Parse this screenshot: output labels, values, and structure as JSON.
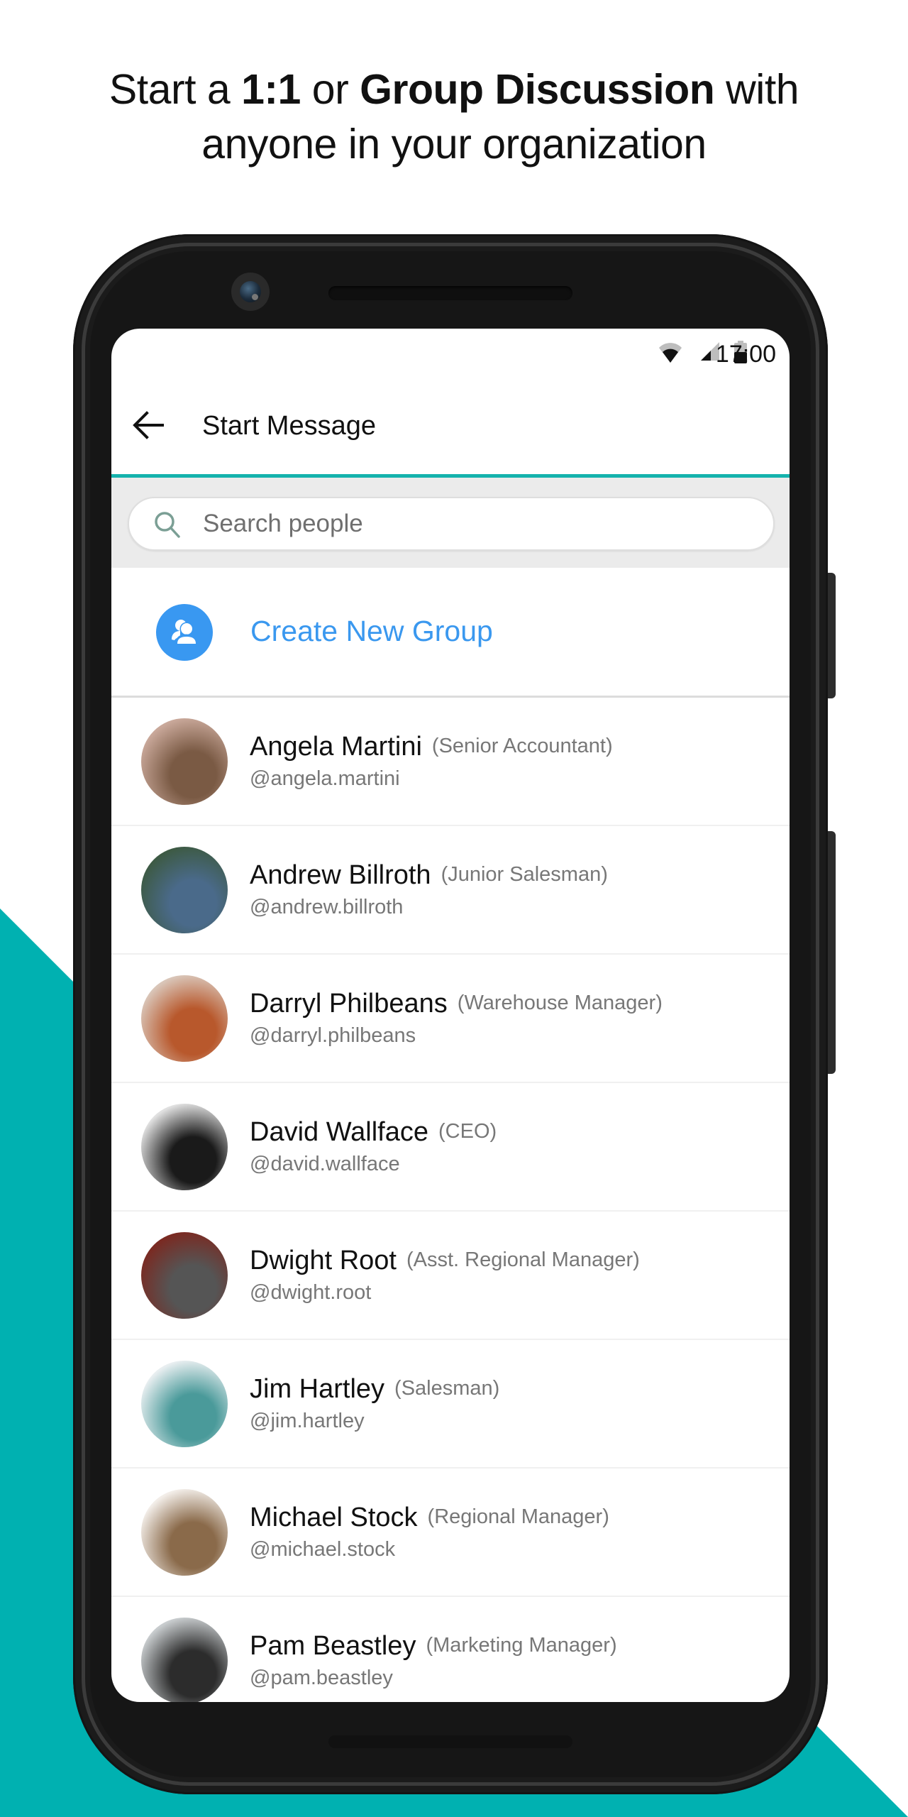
{
  "headline": {
    "line1_pre": "Start a ",
    "line1_bold1": "1:1",
    "line1_mid": " or ",
    "line1_bold2": "Group Discussion",
    "line1_post": " with",
    "line2": "anyone in your organization"
  },
  "colors": {
    "teal": "#00b1b1",
    "accent_blue": "#3a98ef",
    "app_bar_underline": "#14b2ad"
  },
  "status_bar": {
    "time": "17:00",
    "icons": [
      "wifi-icon",
      "cellular-signal-icon",
      "battery-icon"
    ]
  },
  "app_bar": {
    "back_icon": "arrow-left-icon",
    "title": "Start Message"
  },
  "search": {
    "icon": "search-icon",
    "placeholder": "Search people",
    "value": ""
  },
  "create_group": {
    "icon": "group-add-icon",
    "label": "Create New Group"
  },
  "contacts": [
    {
      "name": "Angela Martini",
      "role": "(Senior Accountant)",
      "handle": "@angela.martini",
      "avatar_colors": [
        "#c9a89a",
        "#7a5a44"
      ]
    },
    {
      "name": "Andrew Billroth",
      "role": "(Junior Salesman)",
      "handle": "@andrew.billroth",
      "avatar_colors": [
        "#3d5a44",
        "#4a6a8a"
      ]
    },
    {
      "name": "Darryl Philbeans",
      "role": "(Warehouse Manager)",
      "handle": "@darryl.philbeans",
      "avatar_colors": [
        "#d9c5b8",
        "#b8582c"
      ]
    },
    {
      "name": "David Wallface",
      "role": "(CEO)",
      "handle": "@david.wallface",
      "avatar_colors": [
        "#e0e0e0",
        "#1a1a1a"
      ]
    },
    {
      "name": "Dwight Root",
      "role": "(Asst. Regional Manager)",
      "handle": "@dwight.root",
      "avatar_colors": [
        "#7a2a22",
        "#555555"
      ]
    },
    {
      "name": "Jim Hartley",
      "role": "(Salesman)",
      "handle": "@jim.hartley",
      "avatar_colors": [
        "#e8eef0",
        "#4a9a9a"
      ]
    },
    {
      "name": "Michael Stock",
      "role": "(Regional Manager)",
      "handle": "@michael.stock",
      "avatar_colors": [
        "#f2ede8",
        "#8a6a4a"
      ]
    },
    {
      "name": "Pam Beastley",
      "role": "(Marketing Manager)",
      "handle": "@pam.beastley",
      "avatar_colors": [
        "#c8ccce",
        "#2c2c2c"
      ]
    }
  ]
}
